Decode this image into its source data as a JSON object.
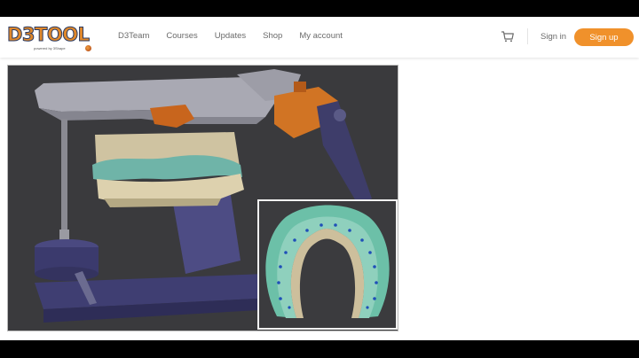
{
  "brand": {
    "logo_text": "D3TOOL",
    "logo_tagline": "powered by 3Shape",
    "accent_color": "#f0912b"
  },
  "nav": {
    "items": [
      {
        "label": "D3Team"
      },
      {
        "label": "Courses"
      },
      {
        "label": "Updates"
      },
      {
        "label": "Shop"
      },
      {
        "label": "My account"
      }
    ],
    "cart_icon": "cart-icon",
    "signin_label": "Sign in",
    "signup_label": "Sign up"
  },
  "media": {
    "main_scene": "dental articulator with models",
    "inset_scene": "night guard splint"
  }
}
